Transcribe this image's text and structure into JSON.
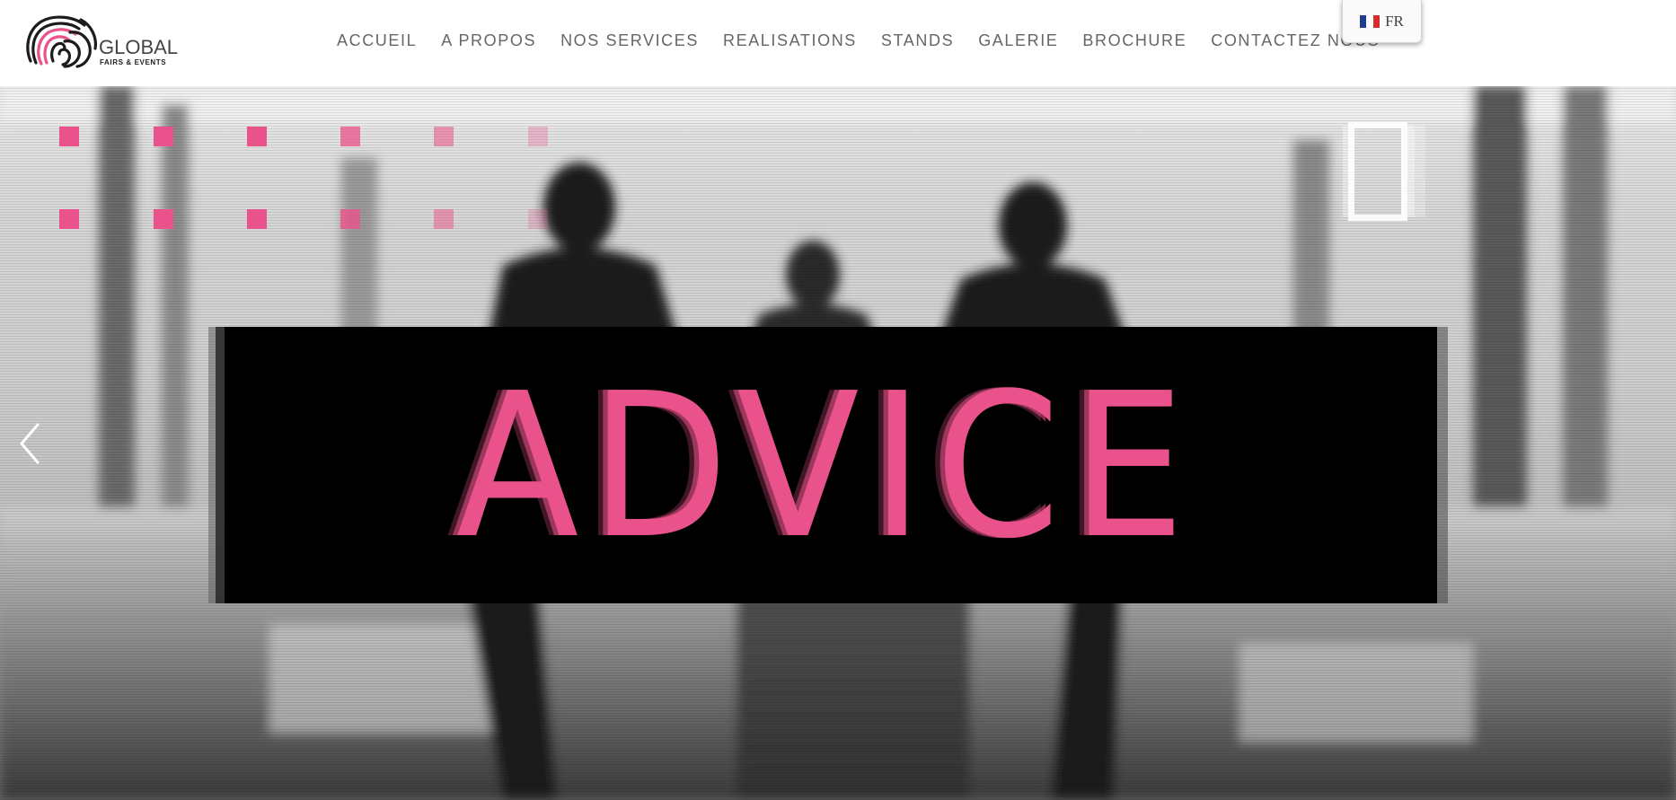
{
  "brand": {
    "name": "GLOBAL",
    "tagline": "FAIRS & EVENTS",
    "accent_color": "#e9528a"
  },
  "nav": {
    "items": [
      {
        "label": "ACCUEIL"
      },
      {
        "label": "A PROPOS"
      },
      {
        "label": "NOS SERVICES"
      },
      {
        "label": "REALISATIONS"
      },
      {
        "label": "STANDS"
      },
      {
        "label": "GALERIE"
      },
      {
        "label": "BROCHURE"
      },
      {
        "label": "CONTACTEZ NOUS"
      }
    ]
  },
  "language": {
    "label": "FR",
    "flag_icon": "france-flag-icon"
  },
  "hero": {
    "headline": "ADVICE",
    "prev_icon": "chevron-left-icon"
  }
}
